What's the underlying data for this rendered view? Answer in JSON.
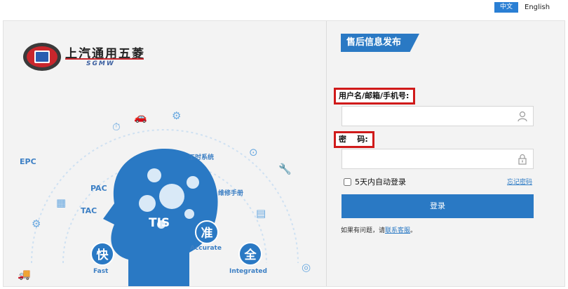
{
  "lang": {
    "zh": "中文",
    "en": "English"
  },
  "brand": {
    "name": "上汽通用五菱",
    "sub": "SGMW",
    "badge": "GM",
    "colors": {
      "primary": "#2a79c4",
      "red": "#c9262c"
    }
  },
  "illustration": {
    "labels": {
      "epc": "EPC",
      "pac": "PAC",
      "tac": "TAC",
      "tis": "TIS",
      "gongshi": "工时系统",
      "weixiu": "维修手册",
      "zhun": "准",
      "accurate": "Accurate",
      "kuai": "快",
      "fast": "Fast",
      "quan": "全",
      "integrated": "Integrated"
    }
  },
  "login": {
    "system_title": "售后信息发布系统",
    "username_label": "用户名/邮箱/手机号:",
    "username_value": "",
    "password_label": "密    码:",
    "password_value": "",
    "remember_label": "5天内自动登录",
    "forgot_label": "忘记密码",
    "submit_label": "登录",
    "help_prefix": "如果有问题，请",
    "help_link": "联系客服",
    "help_suffix": "。"
  }
}
